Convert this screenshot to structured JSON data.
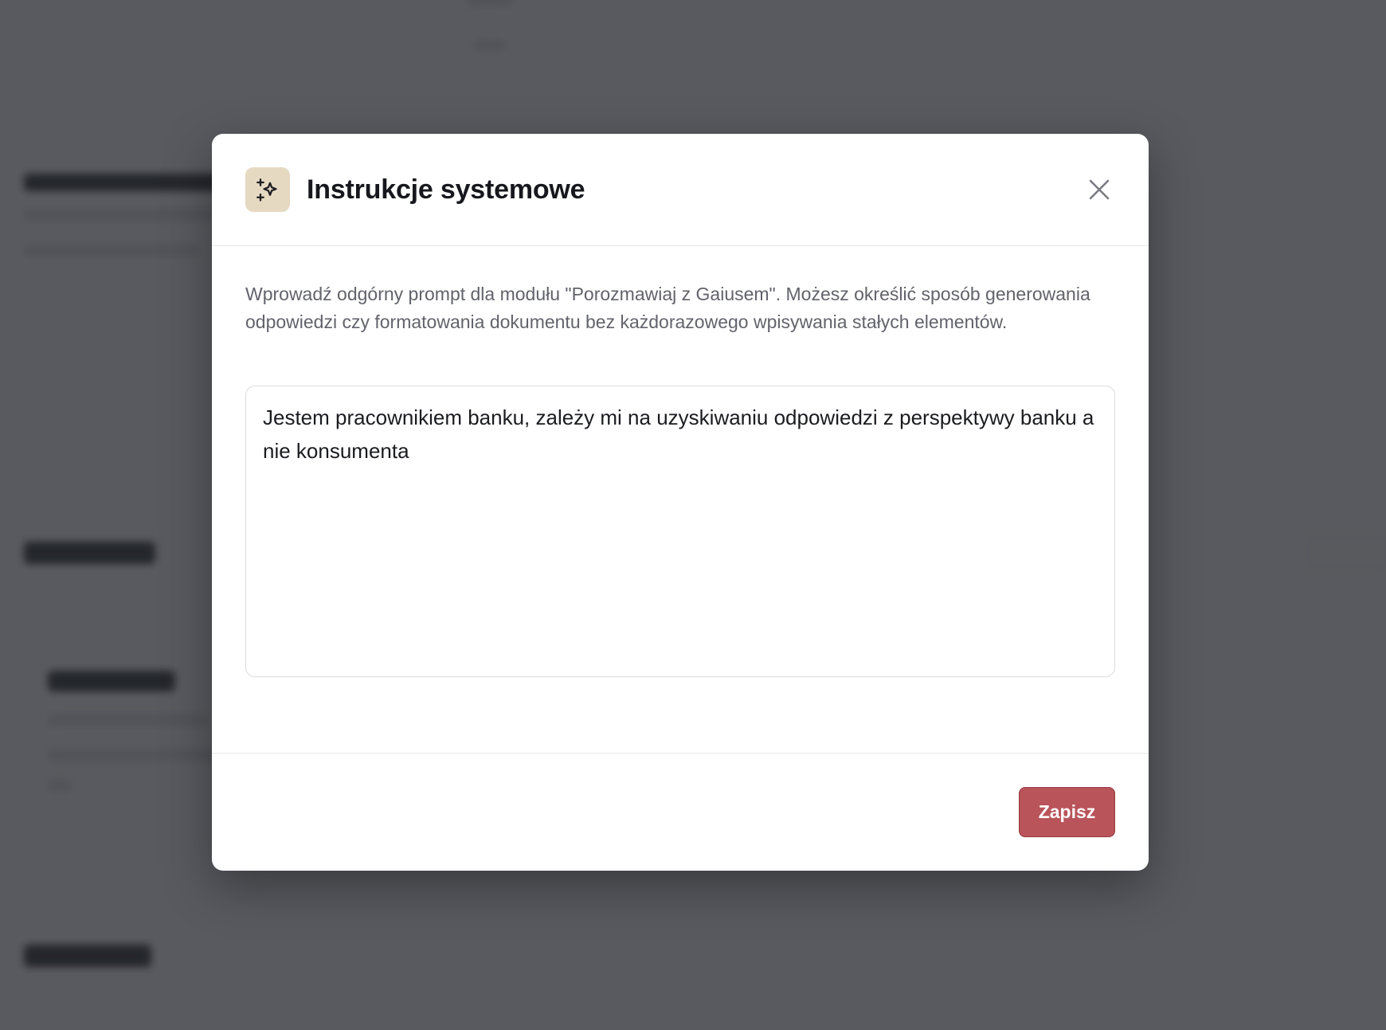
{
  "modal": {
    "title": "Instrukcje systemowe",
    "icon": "sparkles-icon",
    "icon_bg_color": "#e6d9c2",
    "description": "Wprowadź odgórny prompt dla modułu \"Porozmawiaj z Gaiusem\". Możesz określić sposób generowania odpowiedzi czy formatowania dokumentu bez każdorazowego wpisywania stałych elementów.",
    "prompt_value": "Jestem pracownikiem banku, zależy mi na uzyskiwaniu odpowiedzi z perspektywy banku a nie konsumenta",
    "save_label": "Zapisz",
    "save_color": "#b9545a"
  }
}
